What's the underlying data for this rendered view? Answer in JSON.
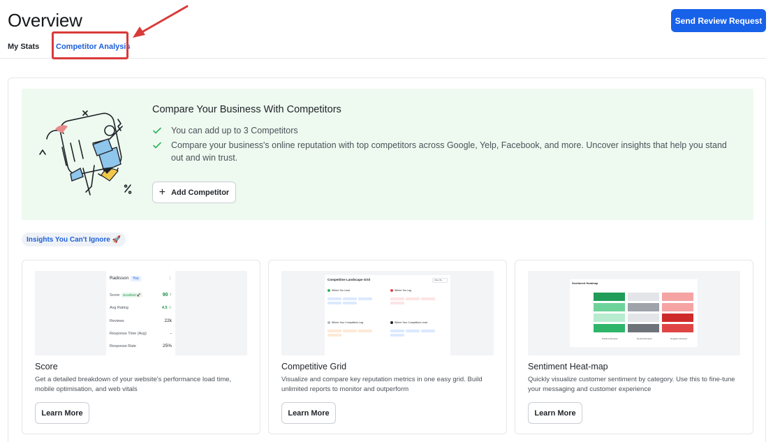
{
  "header": {
    "title": "Overview",
    "send_button": "Send Review Request"
  },
  "tabs": {
    "my_stats": "My Stats",
    "competitor_analysis": "Competitor Analysis"
  },
  "banner": {
    "title": "Compare Your Business With Competitors",
    "bullets": [
      "You can add up to 3 Competitors",
      "Compare your business's online reputation with top competitors across Google, Yelp, Facebook, and more. Uncover insights that help you stand out and win trust."
    ],
    "add_button": "Add Competitor"
  },
  "insights_badge": "Insights You Can't Ignore 🚀",
  "cards": [
    {
      "title": "Score",
      "desc": "Get a detailed breakdown of your website's performance load time, mobile optimisation, and web vitals",
      "button": "Learn More",
      "preview": {
        "name": "Radisson",
        "you": "You",
        "rows": [
          {
            "label": "Score",
            "badge": "Excellent 🚀",
            "value": "90 ↑"
          },
          {
            "label": "Avg Rating",
            "value": "4.5 ☆"
          },
          {
            "label": "Reviews",
            "value": "22k"
          },
          {
            "label": "Response Time (Avg)",
            "value": "-"
          },
          {
            "label": "Response Rate",
            "value": "25%"
          }
        ]
      }
    },
    {
      "title": "Competitive Grid",
      "desc": "Visualize and compare key reputation metrics in one easy grid. Build unlimited reports to monitor and outperform",
      "button": "Learn More",
      "preview": {
        "title": "Competitive Landscape Grid",
        "filter": "Filter By",
        "quadrants": [
          "Where You Lead",
          "Where You Lag",
          "Where Your Competitors Lag",
          "Where Your Competitors Lead"
        ]
      }
    },
    {
      "title": "Sentiment Heat-map",
      "desc": "Quickly visualize customer sentiment by category. Use this to fine-tune your messaging and customer experience",
      "button": "Learn More",
      "preview": {
        "title": "Sentiment Heatmap",
        "columns": [
          "Positive Reviews",
          "Neutral Reviews",
          "Negative Reviews"
        ]
      }
    }
  ],
  "colors": {
    "primary": "#1862ea",
    "banner_bg": "#eefaf0",
    "highlight": "#d93a3a",
    "check": "#2fb35b"
  }
}
